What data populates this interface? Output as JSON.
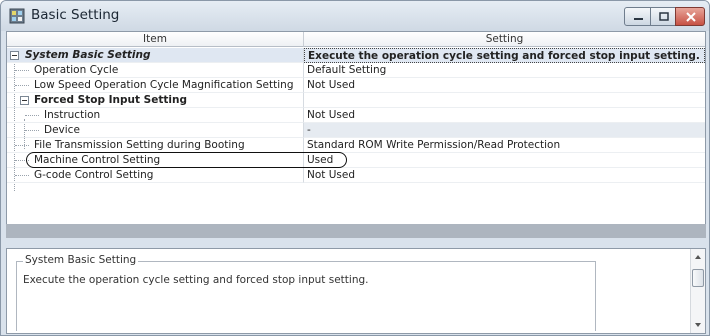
{
  "window": {
    "title": "Basic Setting",
    "accent_close": "#c75244"
  },
  "grid": {
    "columns": [
      "Item",
      "Setting"
    ],
    "rows": [
      {
        "item": "System Basic Setting",
        "setting": "Execute the operation cycle setting and forced stop input setting."
      },
      {
        "item": "Operation Cycle",
        "setting": "Default Setting"
      },
      {
        "item": "Low Speed Operation Cycle Magnification Setting",
        "setting": "Not Used"
      },
      {
        "item": "Forced Stop Input Setting",
        "setting": ""
      },
      {
        "item": "Instruction",
        "setting": "Not Used"
      },
      {
        "item": "Device",
        "setting": "-"
      },
      {
        "item": "File Transmission Setting during Booting",
        "setting": "Standard ROM Write Permission/Read Protection"
      },
      {
        "item": "Machine Control Setting",
        "setting": "Used"
      },
      {
        "item": "G-code Control Setting",
        "setting": "Not Used"
      }
    ]
  },
  "description": {
    "title": "System Basic Setting",
    "text": "Execute the operation cycle setting and forced stop input setting."
  }
}
